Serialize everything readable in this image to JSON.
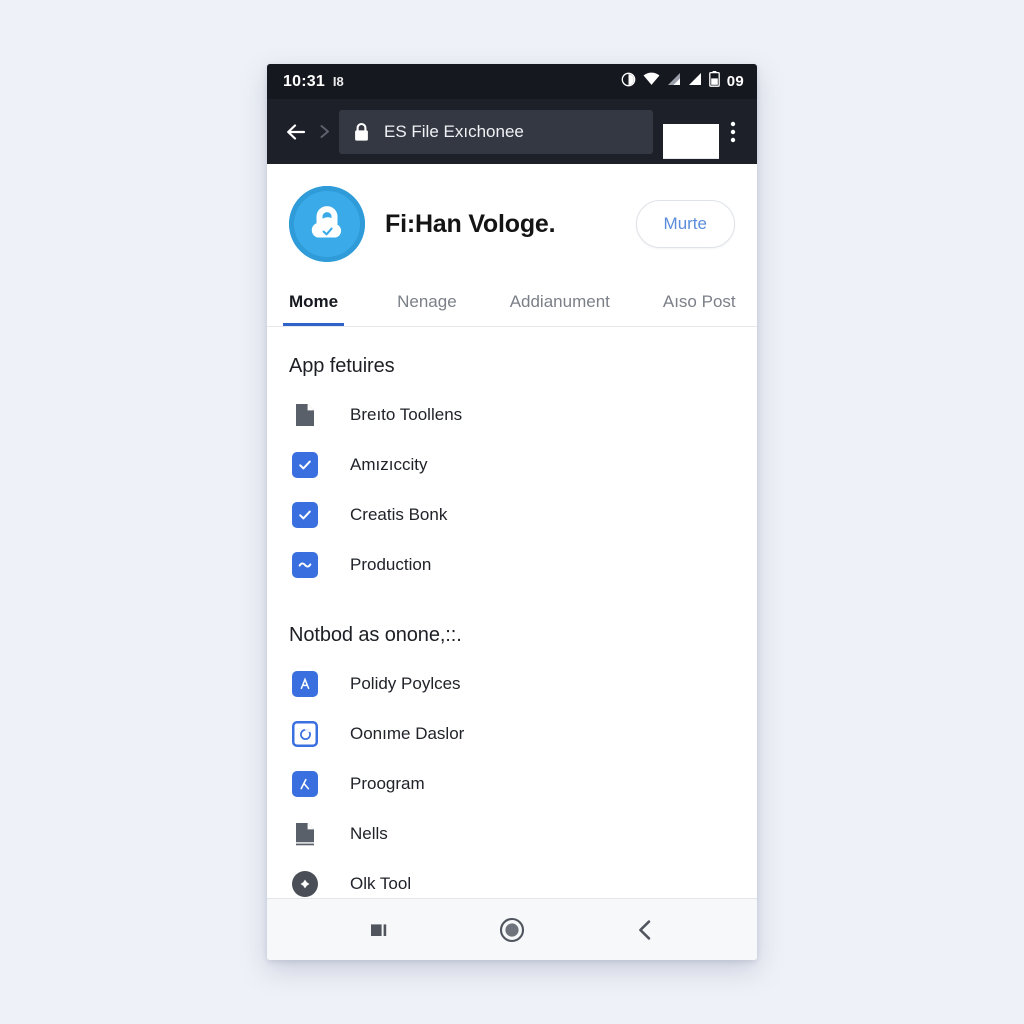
{
  "statusbar": {
    "time": "10:31",
    "left_glyph": "I8",
    "battery_level": "09",
    "icons": [
      "sync-circle-icon",
      "wifi-icon",
      "signal-bars-icon",
      "signal-bars-icon",
      "battery-icon"
    ]
  },
  "browser": {
    "back_icon": "arrow-left-icon",
    "forward_icon": "chevron-right-icon",
    "lock_icon": "lock-icon",
    "url_text": "ES File Exıchonee",
    "tabs_icon": "tab-switcher-icon",
    "menu_icon": "overflow-menu-icon"
  },
  "app": {
    "icon_name": "padlock-cloud-app-icon",
    "title": "Fi:Han Vologe.",
    "action_label": "Murte"
  },
  "tabs": [
    {
      "label": "Mome",
      "active": true
    },
    {
      "label": "Nenage",
      "active": false
    },
    {
      "label": "Addianument",
      "active": false
    },
    {
      "label": "Aıso Post",
      "active": false
    }
  ],
  "sections": [
    {
      "title": "App fetuires",
      "items": [
        {
          "label": "Breıto Toollens",
          "icon": "document-icon"
        },
        {
          "label": "Amızıccity",
          "icon": "check-square-icon"
        },
        {
          "label": "Creatis Bonk",
          "icon": "check-square-icon"
        },
        {
          "label": "Production",
          "icon": "wave-square-icon"
        }
      ]
    },
    {
      "title": "Notbod as onone,::.",
      "items": [
        {
          "label": "Polidy Poylces",
          "icon": "letter-a-square-icon"
        },
        {
          "label": "Oonıme Daslor",
          "icon": "circle-square-outline-icon"
        },
        {
          "label": "Proogram",
          "icon": "lambda-square-icon"
        },
        {
          "label": "Nells",
          "icon": "document-icon"
        },
        {
          "label": "Olk Tool",
          "icon": "plus-circle-icon"
        }
      ]
    }
  ],
  "navbar": {
    "recents_icon": "recents-icon",
    "home_icon": "home-circle-icon",
    "back_icon": "back-chevron-icon"
  },
  "colors": {
    "accent_blue": "#3a6fdf",
    "tab_underline": "#2f63c9",
    "app_icon_blue": "#3aabe8",
    "status_bar": "#15181f",
    "toolbar": "#1d2029",
    "page_bg": "#eef1f7"
  }
}
